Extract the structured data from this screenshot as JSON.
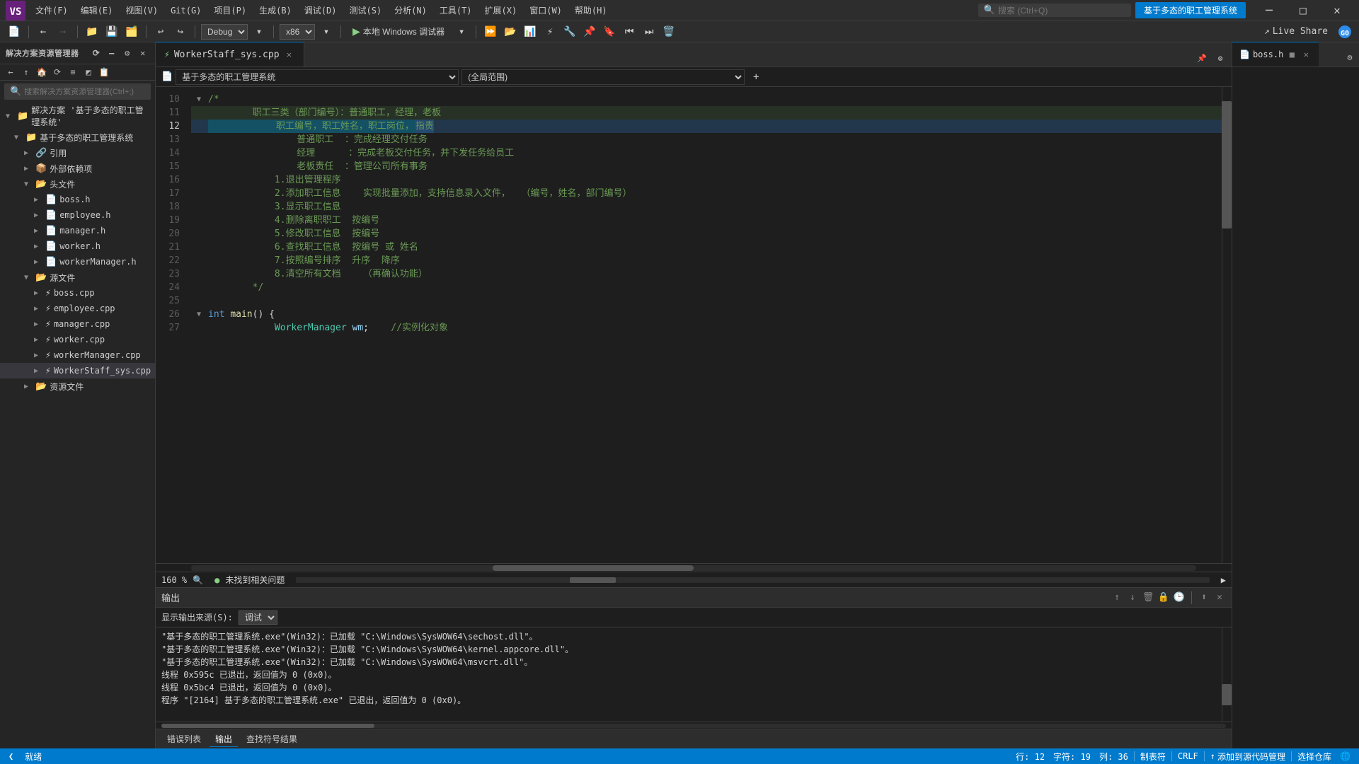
{
  "app": {
    "title": "基于多态的职工管理系统",
    "logo": "VS"
  },
  "menubar": {
    "items": [
      {
        "label": "文件(F)",
        "id": "file"
      },
      {
        "label": "编辑(E)",
        "id": "edit"
      },
      {
        "label": "视图(V)",
        "id": "view"
      },
      {
        "label": "Git(G)",
        "id": "git"
      },
      {
        "label": "项目(P)",
        "id": "project"
      },
      {
        "label": "生成(B)",
        "id": "build"
      },
      {
        "label": "调试(D)",
        "id": "debug"
      },
      {
        "label": "测试(S)",
        "id": "test"
      },
      {
        "label": "分析(N)",
        "id": "analyze"
      },
      {
        "label": "工具(T)",
        "id": "tools"
      },
      {
        "label": "扩展(X)",
        "id": "extensions"
      },
      {
        "label": "窗口(W)",
        "id": "window"
      },
      {
        "label": "帮助(H)",
        "id": "help"
      }
    ],
    "search_placeholder": "搜索 (Ctrl+Q)",
    "project_title": "基于多态的职工管理系统"
  },
  "toolbar": {
    "debug_config": "Debug",
    "platform": "x86",
    "run_label": "本地 Windows 调试器",
    "live_share": "Live Share"
  },
  "sidebar": {
    "title": "解决方案资源管理器",
    "search_placeholder": "搜索解决方案资源管理器(Ctrl+;)",
    "tree": {
      "solution_label": "解决方案 '基于多态的职工管理系统'",
      "project_label": "基于多态的职工管理系统",
      "refs_label": "引用",
      "ext_deps_label": "外部依赖项",
      "headers_label": "头文件",
      "boss_h": "boss.h",
      "employee_h": "employee.h",
      "manager_h": "manager.h",
      "worker_h": "worker.h",
      "workerManager_h": "workerManager.h",
      "sources_label": "源文件",
      "boss_cpp": "boss.cpp",
      "employee_cpp": "employee.cpp",
      "manager_cpp": "manager.cpp",
      "worker_cpp": "worker.cpp",
      "workerManager_cpp": "workerManager.cpp",
      "workerStaff_cpp": "WorkerStaff_sys.cpp",
      "resources_label": "资源文件"
    }
  },
  "tabs": {
    "main_tab": "WorkerStaff_sys.cpp",
    "right_tab": "boss.h"
  },
  "scope_bar": {
    "file_icon": "📄",
    "file_name": "基于多态的职工管理系统",
    "scope": "(全局范围)"
  },
  "code_lines": [
    {
      "num": 10,
      "content": "    /*",
      "type": "comment_start",
      "fold": true
    },
    {
      "num": 11,
      "content": "        职工三类（部门编号）：普通职工，经理，老板",
      "type": "comment"
    },
    {
      "num": 12,
      "content": "            职工编号，职工姓名，职工岗位，指责",
      "type": "comment",
      "highlight_yellow": true
    },
    {
      "num": 13,
      "content": "                普通职工  ：完成经理交付任务",
      "type": "comment"
    },
    {
      "num": 14,
      "content": "                经理      ：完成老板交付任务，并下发任务给员工",
      "type": "comment"
    },
    {
      "num": 15,
      "content": "                老板责任  ：管理公司所有事务",
      "type": "comment"
    },
    {
      "num": 16,
      "content": "            1.退出管理程序",
      "type": "comment"
    },
    {
      "num": 17,
      "content": "            2.添加职工信息    实现批量添加，支持信息录入文件，  （编号，姓名，部门编号）",
      "type": "comment"
    },
    {
      "num": 18,
      "content": "            3.显示职工信息",
      "type": "comment"
    },
    {
      "num": 19,
      "content": "            4.删除离职职工  按编号",
      "type": "comment"
    },
    {
      "num": 20,
      "content": "            5.修改职工信息  按编号",
      "type": "comment"
    },
    {
      "num": 21,
      "content": "            6.查找职工信息  按编号 或 姓名",
      "type": "comment"
    },
    {
      "num": 22,
      "content": "            7.按照编号排序  升序  降序",
      "type": "comment"
    },
    {
      "num": 23,
      "content": "            8.清空所有文档    （再确认功能）",
      "type": "comment"
    },
    {
      "num": 24,
      "content": "        */",
      "type": "comment_end"
    },
    {
      "num": 25,
      "content": "",
      "type": "empty"
    },
    {
      "num": 26,
      "content": "    int main() {",
      "type": "code",
      "fold": true
    },
    {
      "num": 27,
      "content": "            WorkerManager wm;    //实例化对象",
      "type": "code"
    }
  ],
  "status_bar": {
    "zoom": "160 %",
    "no_issues": "未找到相关问题",
    "line": "行: 12",
    "char": "字符: 19",
    "col": "列: 36",
    "indent": "制表符",
    "encoding": "CRLF"
  },
  "output_panel": {
    "title": "输出",
    "source_label": "显示输出来源(S):",
    "source": "调试",
    "tabs": [
      "错误列表",
      "输出",
      "查找符号结果"
    ],
    "lines": [
      "\"基于多态的职工管理系统.exe\"(Win32)：已加载 \"C:\\Windows\\SysWOW64\\sechost.dll\"。",
      "\"基于多态的职工管理系统.exe\"(Win32)：已加载 \"C:\\Windows\\SysWOW64\\kernel.appcore.dll\"。",
      "\"基于多态的职工管理系统.exe\"(Win32)：已加载 \"C:\\Windows\\SysWOW64\\msvcrt.dll\"。",
      "线程 0x595c 已退出，返回值为 0 (0x0)。",
      "线程 0x5bc4 已退出，返回值为 0 (0x0)。",
      "程序 \"[2164] 基于多态的职工管理系统.exe\" 已退出，返回值为 0 (0x0)。"
    ]
  },
  "bottom_bar": {
    "left_icon": "❮",
    "status": "就绪",
    "add_code": "添加到源代码管理",
    "select_repo": "选择仓库",
    "right_icons": "🌐"
  }
}
